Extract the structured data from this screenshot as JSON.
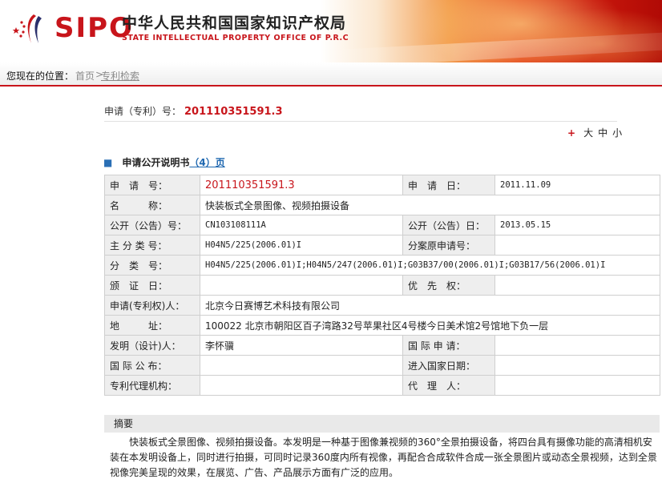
{
  "header": {
    "logo_text": "SIPO",
    "org_name_cn": "中华人民共和国国家知识产权局",
    "org_name_en": "STATE INTELLECTUAL PROPERTY OFFICE OF P.R.C",
    "accent_color": "#c8151b"
  },
  "breadcrumb": {
    "label": "您现在的位置：",
    "home": "首页",
    "separator": ">",
    "current": "专利检索"
  },
  "application": {
    "label": "申请（专利）号：",
    "number": "201110351591.3"
  },
  "font_size_control": {
    "plus_icon": "+",
    "large": "大",
    "medium": "中",
    "small": "小"
  },
  "section": {
    "bullet": "■",
    "title": "申请公开说明书",
    "pages": "（4）页"
  },
  "table": {
    "rows": [
      {
        "label1": "申　请　号：",
        "value1": "201110351591.3",
        "label2": "申　请　日：",
        "value2": "2011.11.09"
      },
      {
        "label1": "名　　　称：",
        "value1": "快装板式全景图像、视频拍摄设备"
      },
      {
        "label1": "公开（公告）号：",
        "value1": "CN103108111A",
        "label2": "公开（公告）日：",
        "value2": "2013.05.15"
      },
      {
        "label1": "主 分 类 号：",
        "value1": "H04N5/225(2006.01)I",
        "label2": "分案原申请号：",
        "value2": ""
      },
      {
        "label1": "分　类　号：",
        "value1": "H04N5/225(2006.01)I;H04N5/247(2006.01)I;G03B37/00(2006.01)I;G03B17/56(2006.01)I"
      },
      {
        "label1": "颁　证　日：",
        "value1": "",
        "label2": "优　先　权：",
        "value2": ""
      },
      {
        "label1": "申请(专利权)人：",
        "value1": "北京今日赛博艺术科技有限公司"
      },
      {
        "label1": "地　　　址：",
        "value1": "100022 北京市朝阳区百子湾路32号苹果社区4号楼今日美术馆2号馆地下负一层"
      },
      {
        "label1": "发明（设计)人：",
        "value1": "李怀骥",
        "label2": "国 际 申 请：",
        "value2": ""
      },
      {
        "label1": "国 际 公 布：",
        "value1": "",
        "label2": "进入国家日期：",
        "value2": ""
      },
      {
        "label1": "专利代理机构：",
        "value1": "",
        "label2": "代　理　人：",
        "value2": ""
      }
    ]
  },
  "abstract": {
    "heading": "摘要",
    "text": "快装板式全景图像、视频拍摄设备。本发明是一种基于图像兼视频的360°全景拍摄设备，将四台具有摄像功能的高清相机安装在本发明设备上，同时进行拍摄，可同时记录360度内所有视像，再配合合成软件合成一张全景图片或动态全景视频，达到全景视像完美呈现的效果，在展览、广告、产品展示方面有广泛的应用。"
  }
}
